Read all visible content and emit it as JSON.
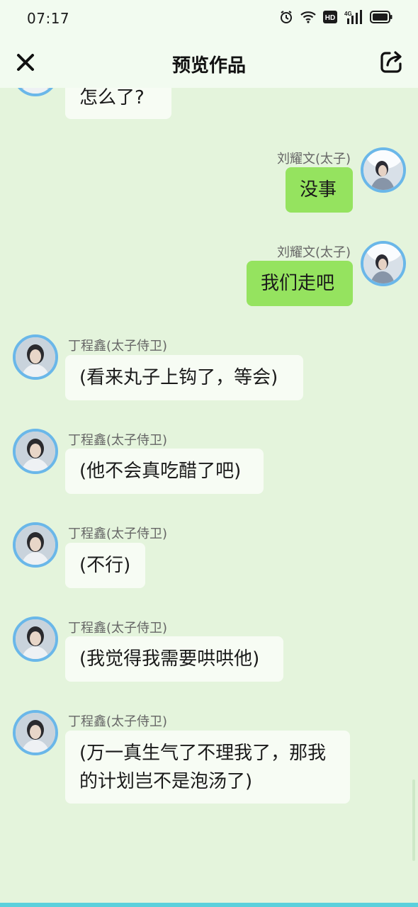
{
  "status_bar": {
    "time": "07:17",
    "network": "4G",
    "hd": "HD"
  },
  "navbar": {
    "title": "预览作品"
  },
  "messages": [
    {
      "side": "left",
      "name": "",
      "text": "怎么了?"
    },
    {
      "side": "right",
      "name": "刘耀文(太子)",
      "text": "没事"
    },
    {
      "side": "right",
      "name": "刘耀文(太子)",
      "text": "我们走吧"
    },
    {
      "side": "left",
      "name": "丁程鑫(太子侍卫)",
      "text": "(看来丸子上钩了，等会)"
    },
    {
      "side": "left",
      "name": "丁程鑫(太子侍卫)",
      "text": "(他不会真吃醋了吧)"
    },
    {
      "side": "left",
      "name": "丁程鑫(太子侍卫)",
      "text": "(不行)"
    },
    {
      "side": "left",
      "name": "丁程鑫(太子侍卫)",
      "text": "(我觉得我需要哄哄他)"
    },
    {
      "side": "left",
      "name": "丁程鑫(太子侍卫)",
      "text": "(万一真生气了不理我了，那我的计划岂不是泡汤了)"
    }
  ],
  "colors": {
    "background": "#e4f4dc",
    "bubble_left": "#f7fcf4",
    "bubble_right": "#95e35f",
    "avatar_ring": "#6ab7e9"
  }
}
